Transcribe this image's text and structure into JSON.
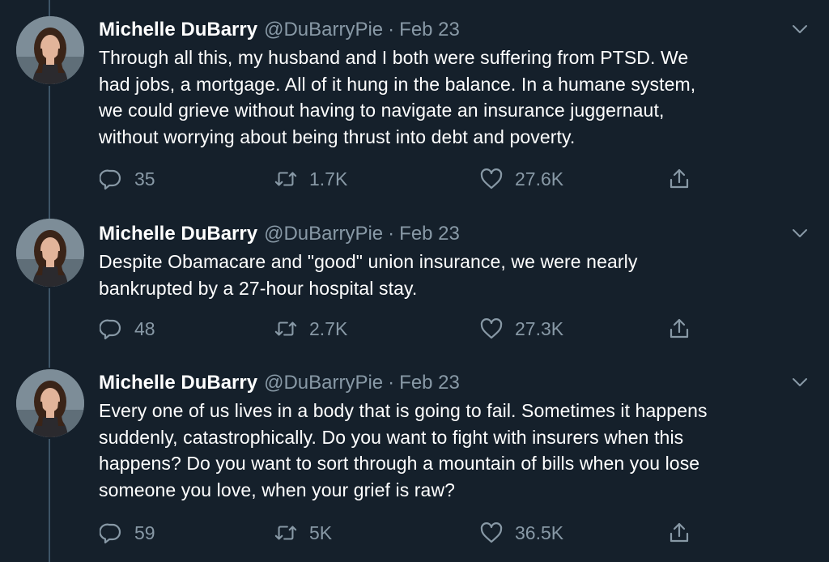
{
  "colors": {
    "background": "#15202b",
    "text_primary": "#ffffff",
    "text_secondary": "#8899a6",
    "thread_line": "#3d5466"
  },
  "tweets": [
    {
      "author_name": "Michelle DuBarry",
      "handle": "@DuBarryPie",
      "separator": "·",
      "date": "Feb 23",
      "lines": [
        "Through all this, my husband and I both were suffering from PTSD. We",
        "had jobs, a mortgage. All of it hung in the balance. In a humane system,",
        "we could grieve without having to navigate an insurance juggernaut,",
        "without worrying about being thrust into debt and poverty."
      ],
      "replies": "35",
      "retweets": "1.7K",
      "likes": "27.6K",
      "icons": [
        "reply-icon",
        "retweet-icon",
        "like-icon",
        "share-icon"
      ]
    },
    {
      "author_name": "Michelle DuBarry",
      "handle": "@DuBarryPie",
      "separator": "·",
      "date": "Feb 23",
      "lines": [
        "Despite Obamacare and \"good\" union insurance, we were nearly",
        "bankrupted by a 27-hour hospital stay."
      ],
      "replies": "48",
      "retweets": "2.7K",
      "likes": "27.3K",
      "icons": [
        "reply-icon",
        "retweet-icon",
        "like-icon",
        "share-icon"
      ]
    },
    {
      "author_name": "Michelle DuBarry",
      "handle": "@DuBarryPie",
      "separator": "·",
      "date": "Feb 23",
      "lines": [
        "Every one of us lives in a body that is going to fail. Sometimes it happens",
        "suddenly, catastrophically. Do you want to fight with insurers when this",
        "happens? Do you want to sort through a mountain of bills when you lose",
        "someone you love, when your grief is raw?"
      ],
      "replies": "59",
      "retweets": "5K",
      "likes": "36.5K",
      "icons": [
        "reply-icon",
        "retweet-icon",
        "like-icon",
        "share-icon"
      ]
    }
  ]
}
